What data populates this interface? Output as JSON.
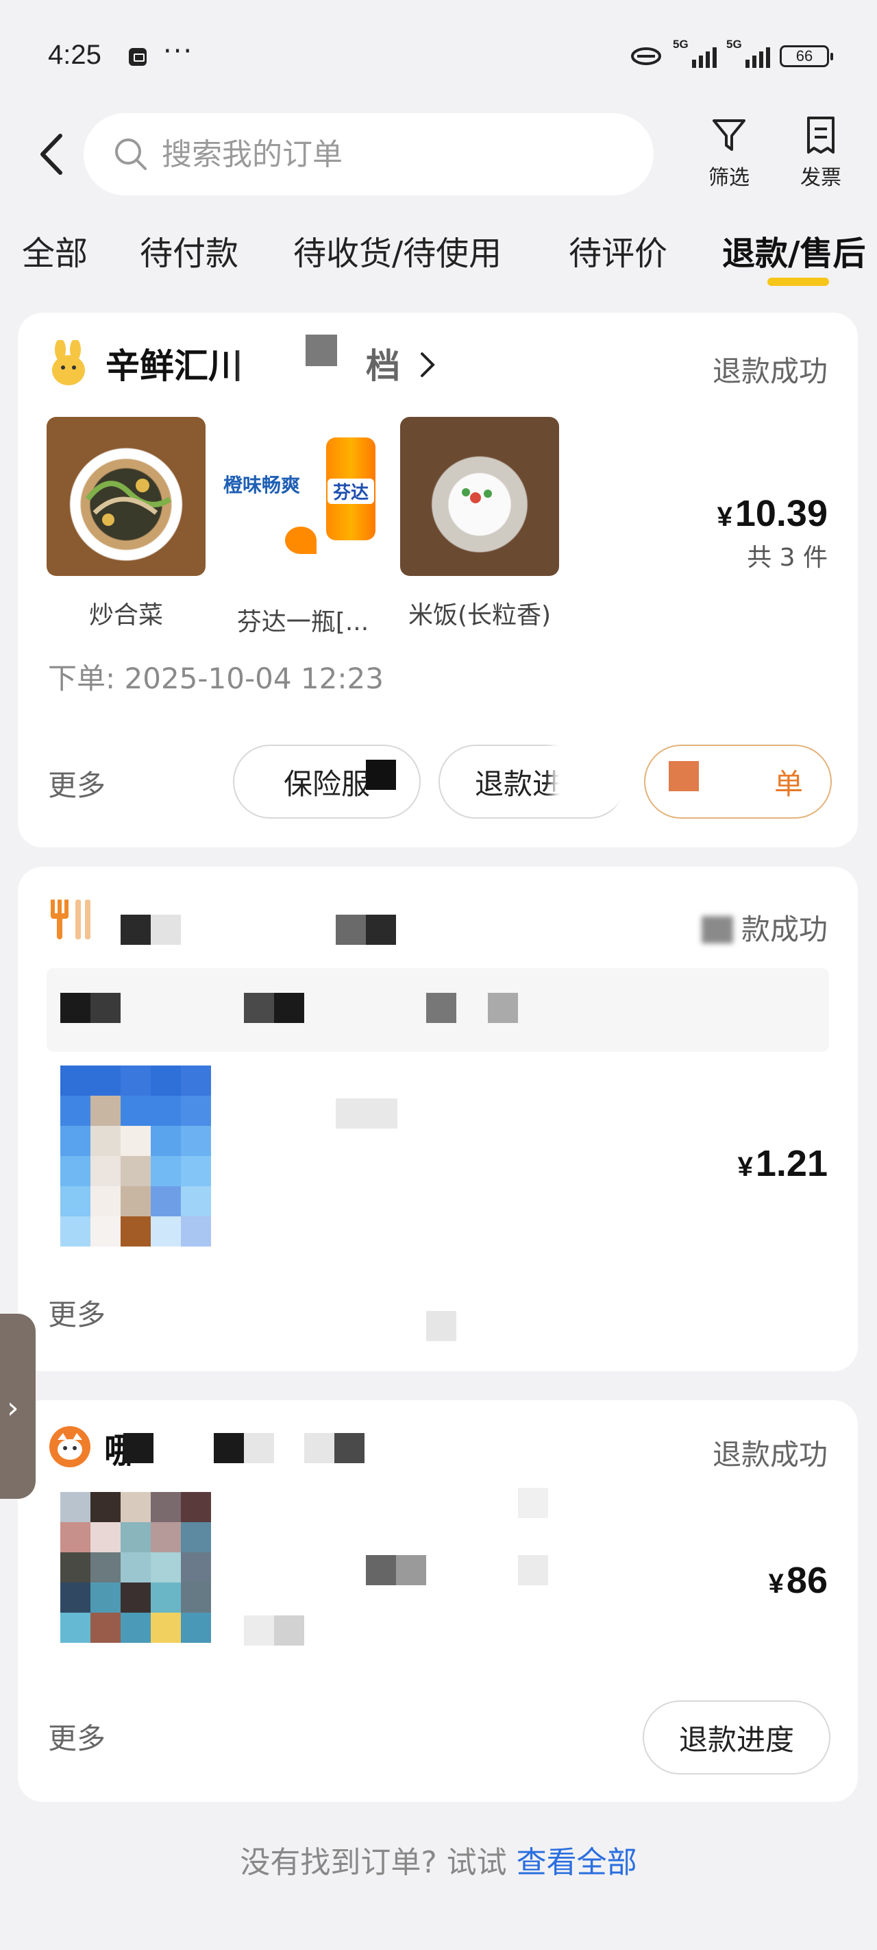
{
  "status_bar": {
    "time": "4:25",
    "dots": "···",
    "sig1": "5G",
    "sig2": "5G",
    "battery": "66"
  },
  "header": {
    "search_placeholder": "搜索我的订单",
    "filter_label": "筛选",
    "invoice_label": "发票"
  },
  "tabs": [
    {
      "label": "全部"
    },
    {
      "label": "待付款"
    },
    {
      "label": "待收货/待使用"
    },
    {
      "label": "待评价"
    },
    {
      "label": "退款/售后",
      "active": true
    }
  ],
  "orders": [
    {
      "shop_name": "辛鲜汇川",
      "shop_name_tail": "档",
      "status": "退款成功",
      "items": [
        {
          "name": "炒合菜",
          "image": "stir-fry-dish"
        },
        {
          "name": "芬达一瓶[...",
          "image": "fanta-can",
          "img_text1": "橙味畅爽",
          "img_text2": "芬达"
        },
        {
          "name": "米饭(长粒香)",
          "image": "rice-bowl"
        }
      ],
      "price": "10.39",
      "currency": "¥",
      "count": "共 3 件",
      "order_time": "下单: 2025-10-04 12:23",
      "more": "更多",
      "buttons": [
        "保险服",
        "退款进度",
        "单"
      ]
    },
    {
      "status": "款成功",
      "price": "1.21",
      "currency": "¥",
      "more": "更多"
    },
    {
      "shop_name": "哪",
      "status": "退款成功",
      "price": "86",
      "currency": "¥",
      "more": "更多",
      "buttons": [
        "退款进度"
      ]
    }
  ],
  "footer": {
    "text": "没有找到订单? 试试 ",
    "link": "查看全部"
  },
  "colors": {
    "accent": "#f5c518",
    "link": "#2a6ee0",
    "orange": "#e77a29"
  }
}
